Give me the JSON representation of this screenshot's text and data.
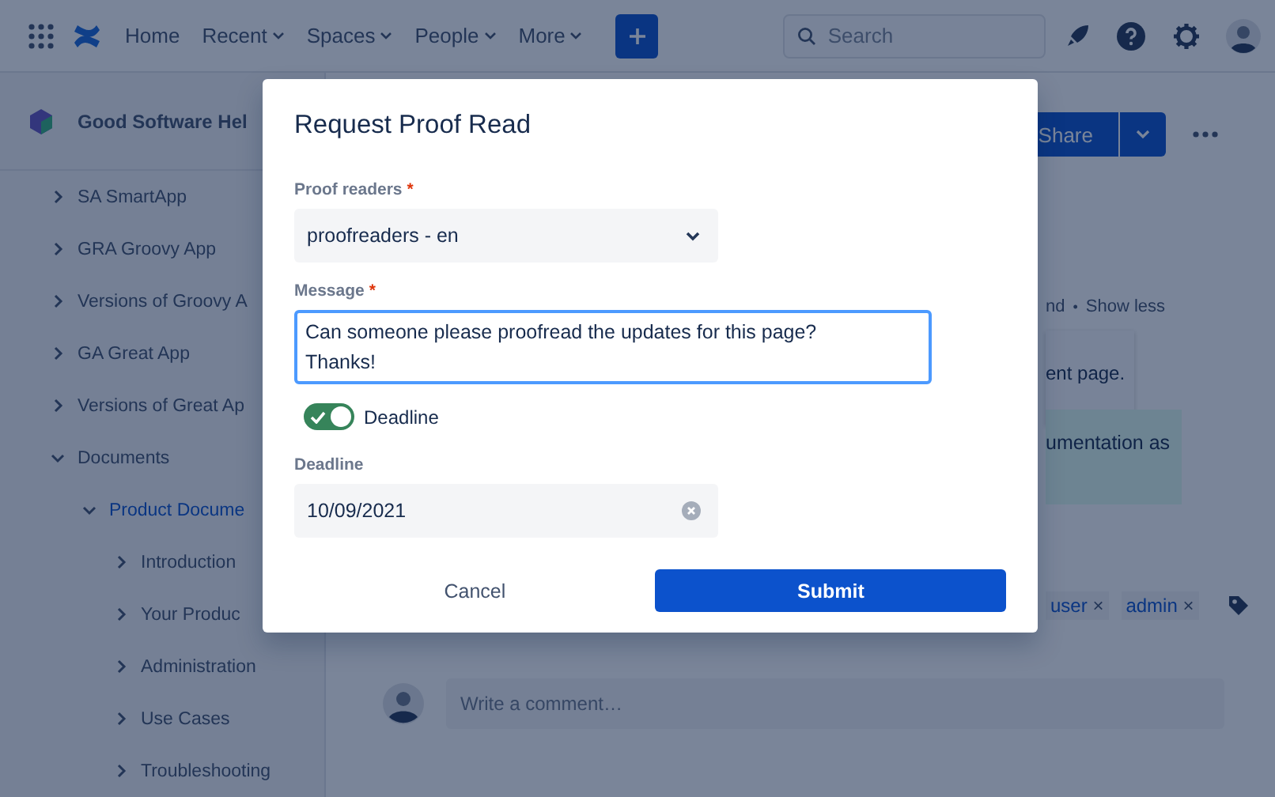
{
  "top_nav": {
    "items": [
      {
        "label": "Home",
        "has_menu": false
      },
      {
        "label": "Recent",
        "has_menu": true
      },
      {
        "label": "Spaces",
        "has_menu": true
      },
      {
        "label": "People",
        "has_menu": true
      },
      {
        "label": "More",
        "has_menu": true
      }
    ],
    "search": {
      "placeholder": "Search"
    }
  },
  "space": {
    "name": "Good Software Hel"
  },
  "sidebar": {
    "items": [
      {
        "label": "SA SmartApp",
        "expanded": false,
        "selected": false
      },
      {
        "label": "GRA Groovy App",
        "expanded": false,
        "selected": false
      },
      {
        "label": "Versions of Groovy A",
        "expanded": false,
        "selected": false
      },
      {
        "label": "GA Great App",
        "expanded": false,
        "selected": false
      },
      {
        "label": "Versions of Great Ap",
        "expanded": false,
        "selected": false
      },
      {
        "label": "Documents",
        "expanded": true,
        "selected": false,
        "children": [
          {
            "label": "Product Docume",
            "expanded": true,
            "selected": true,
            "children": [
              {
                "label": "Introduction",
                "expanded": false,
                "selected": false
              },
              {
                "label": "Your Produc",
                "expanded": false,
                "selected": false
              },
              {
                "label": "Administration",
                "expanded": false,
                "selected": false
              },
              {
                "label": "Use Cases",
                "expanded": false,
                "selected": false
              },
              {
                "label": "Troubleshooting",
                "expanded": false,
                "selected": false
              }
            ]
          }
        ]
      }
    ]
  },
  "page_actions": {
    "share": "Share"
  },
  "page": {
    "byline_fragment": "nd",
    "separator": "•",
    "show_less": "Show less",
    "panel_fragment": "ent page.",
    "info_fragment": "umentation as",
    "labels": [
      {
        "text": "user",
        "remove": "×"
      },
      {
        "text": "admin",
        "remove": "×"
      }
    ],
    "comment": {
      "placeholder": "Write a comment…"
    }
  },
  "dialog": {
    "title": "Request Proof Read",
    "fields": [
      {
        "kind": "select",
        "label": "Proof readers",
        "required_mark": "*",
        "value": "proofreaders - en"
      },
      {
        "kind": "textarea",
        "label": "Message",
        "required_mark": "*",
        "value": "Can someone please proofread the updates for this page?\nThanks!",
        "focused": true
      },
      {
        "kind": "toggle",
        "label": "Deadline",
        "on": true
      },
      {
        "kind": "date",
        "label": "Deadline",
        "value": "10/09/2021"
      }
    ],
    "buttons": [
      {
        "label": "Cancel",
        "kind": "subtle"
      },
      {
        "label": "Submit",
        "kind": "primary"
      }
    ]
  }
}
